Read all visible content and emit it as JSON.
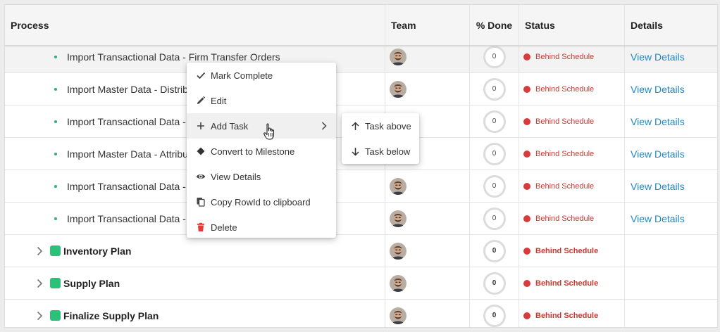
{
  "header": {
    "process": "Process",
    "team": "Team",
    "done": "% Done",
    "status": "Status",
    "details": "Details"
  },
  "rows": [
    {
      "type": "task",
      "name": "Import Transactional Data - Firm Transfer Orders",
      "done": "0",
      "status": "Behind Schedule",
      "details": "View Details"
    },
    {
      "type": "task",
      "name": "Import Master Data - Distrib",
      "done": "0",
      "status": "Behind Schedule",
      "details": "View Details"
    },
    {
      "type": "task",
      "name": "Import Transactional Data -",
      "done": "0",
      "status": "Behind Schedule",
      "details": "View Details"
    },
    {
      "type": "task",
      "name": "Import Master Data - Attribu",
      "done": "0",
      "status": "Behind Schedule",
      "details": "View Details"
    },
    {
      "type": "task",
      "name": "Import Transactional Data -",
      "done": "0",
      "status": "Behind Schedule",
      "details": "View Details"
    },
    {
      "type": "task",
      "name": "Import Transactional Data -",
      "done": "0",
      "status": "Behind Schedule",
      "details": "View Details"
    },
    {
      "type": "group",
      "name": "Inventory Plan",
      "done": "0",
      "status": "Behind Schedule",
      "details": ""
    },
    {
      "type": "group",
      "name": "Supply Plan",
      "done": "0",
      "status": "Behind Schedule",
      "details": ""
    },
    {
      "type": "group",
      "name": "Finalize Supply Plan",
      "done": "0",
      "status": "Behind Schedule",
      "details": ""
    }
  ],
  "context_menu": {
    "items": [
      {
        "label": "Mark Complete",
        "icon": "check-icon"
      },
      {
        "label": "Edit",
        "icon": "pencil-icon"
      },
      {
        "label": "Add Task",
        "icon": "plus-icon"
      },
      {
        "label": "Convert to Milestone",
        "icon": "diamond-icon"
      },
      {
        "label": "View Details",
        "icon": "eye-icon"
      },
      {
        "label": "Copy RowId to clipboard",
        "icon": "copy-icon"
      },
      {
        "label": "Delete",
        "icon": "trash-icon"
      }
    ],
    "submenu": [
      {
        "label": "Task above",
        "icon": "arrow-up-icon"
      },
      {
        "label": "Task below",
        "icon": "arrow-down-icon"
      }
    ]
  },
  "colors": {
    "accent_green": "#2cc178",
    "status_red": "#d83b3b",
    "link_blue": "#1e88c7",
    "delete_red": "#e53935"
  }
}
